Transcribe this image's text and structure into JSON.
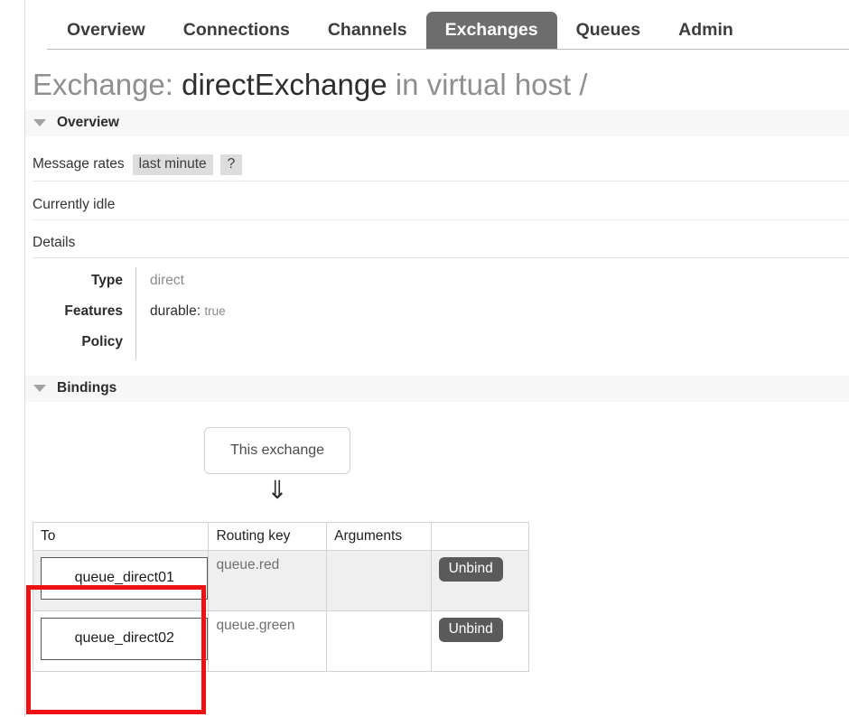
{
  "nav": {
    "tabs": [
      {
        "label": "Overview",
        "active": false
      },
      {
        "label": "Connections",
        "active": false
      },
      {
        "label": "Channels",
        "active": false
      },
      {
        "label": "Exchanges",
        "active": true
      },
      {
        "label": "Queues",
        "active": false
      },
      {
        "label": "Admin",
        "active": false
      }
    ]
  },
  "page": {
    "title_prefix": "Exchange:",
    "title_name": "directExchange",
    "title_suffix": "in virtual host /"
  },
  "overview": {
    "section_label": "Overview",
    "collapse_icon": "triangle-down-icon",
    "message_rates_label": "Message rates",
    "rate_period_chip": "last minute",
    "help_chip": "?",
    "status_text": "Currently idle",
    "details_label": "Details",
    "details": [
      {
        "key": "Type",
        "value": "direct",
        "value_style": "muted"
      },
      {
        "key": "Features",
        "value_dark": "durable:",
        "value_small": "true"
      },
      {
        "key": "Policy",
        "value": ""
      }
    ]
  },
  "bindings": {
    "section_label": "Bindings",
    "collapse_icon": "triangle-down-icon",
    "source_box_label": "This exchange",
    "arrow_glyph": "⇓",
    "table": {
      "columns": [
        "To",
        "Routing key",
        "Arguments",
        ""
      ],
      "rows": [
        {
          "to": "queue_direct01",
          "routing_key": "queue.red",
          "arguments": "",
          "action": "Unbind",
          "shaded": true
        },
        {
          "to": "queue_direct02",
          "routing_key": "queue.green",
          "arguments": "",
          "action": "Unbind",
          "shaded": false
        }
      ]
    }
  },
  "annotation": {
    "color": "#ee1111",
    "target": "to-column-queue-boxes"
  }
}
